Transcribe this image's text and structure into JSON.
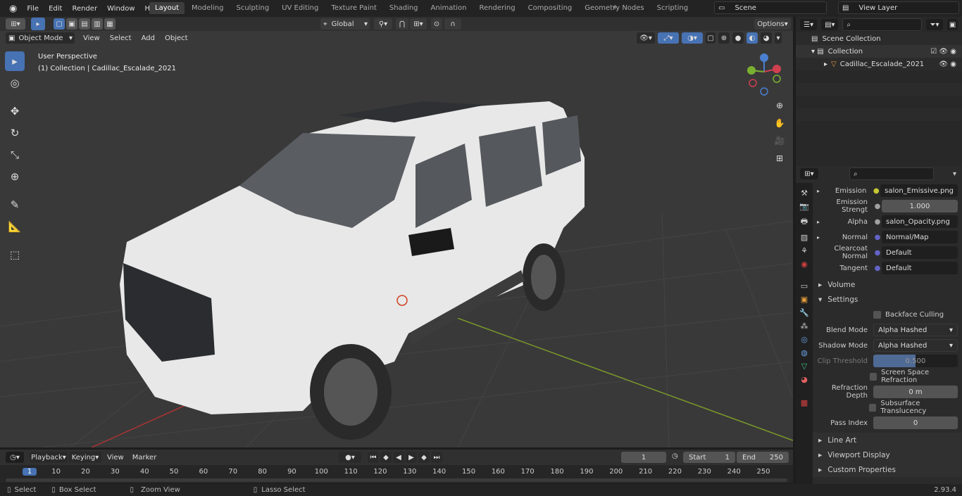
{
  "menu": {
    "file": "File",
    "edit": "Edit",
    "render": "Render",
    "window": "Window",
    "help": "Help"
  },
  "workspaces": [
    "Layout",
    "Modeling",
    "Sculpting",
    "UV Editing",
    "Texture Paint",
    "Shading",
    "Animation",
    "Rendering",
    "Compositing",
    "Geometry Nodes",
    "Scripting"
  ],
  "scene": "Scene",
  "view_layer": "View Layer",
  "viewport": {
    "mode": "Object Mode",
    "view": "View",
    "select": "Select",
    "add": "Add",
    "object": "Object",
    "orientation": "Global",
    "options": "Options",
    "overlay_title": "User Perspective",
    "overlay_sub": "(1) Collection | Cadillac_Escalade_2021"
  },
  "outliner": {
    "scene_collection": "Scene Collection",
    "collection": "Collection",
    "object": "Cadillac_Escalade_2021"
  },
  "properties": {
    "rows": [
      {
        "label": "Emission",
        "value": "salon_Emissive.png",
        "dot": "#c8c836",
        "arrow": true
      },
      {
        "label": "Emission Strengt",
        "value": "1.000",
        "dot": "#a0a0a0",
        "num": true
      },
      {
        "label": "Alpha",
        "value": "salon_Opacity.png",
        "dot": "#a0a0a0",
        "arrow": true
      },
      {
        "label": "Normal",
        "value": "Normal/Map",
        "dot": "#6363c7",
        "arrow": true
      },
      {
        "label": "Clearcoat Normal",
        "value": "Default",
        "dot": "#6363c7"
      },
      {
        "label": "Tangent",
        "value": "Default",
        "dot": "#6363c7"
      }
    ],
    "volume": "Volume",
    "settings": "Settings",
    "backface": "Backface Culling",
    "blend_label": "Blend Mode",
    "blend_value": "Alpha Hashed",
    "shadow_label": "Shadow Mode",
    "shadow_value": "Alpha Hashed",
    "clip_label": "Clip Threshold",
    "clip_value": "0.500",
    "clip_fraction": 0.5,
    "ssr": "Screen Space Refraction",
    "refr_label": "Refraction Depth",
    "refr_value": "0 m",
    "subsurface": "Subsurface Translucency",
    "pass_label": "Pass Index",
    "pass_value": "0",
    "lineart": "Line Art",
    "viewport_display": "Viewport Display",
    "custom_props": "Custom Properties"
  },
  "timeline": {
    "playback": "Playback",
    "keying": "Keying",
    "view": "View",
    "marker": "Marker",
    "frame": "1",
    "start_label": "Start",
    "start": "1",
    "end_label": "End",
    "end": "250",
    "ticks": [
      "1",
      "10",
      "20",
      "30",
      "40",
      "50",
      "60",
      "70",
      "80",
      "90",
      "100",
      "110",
      "120",
      "130",
      "140",
      "150",
      "160",
      "170",
      "180",
      "190",
      "200",
      "210",
      "220",
      "230",
      "240",
      "250"
    ]
  },
  "status": {
    "select": "Select",
    "box_select": "Box Select",
    "zoom": "Zoom View",
    "lasso": "Lasso Select",
    "version": "2.93.4"
  }
}
